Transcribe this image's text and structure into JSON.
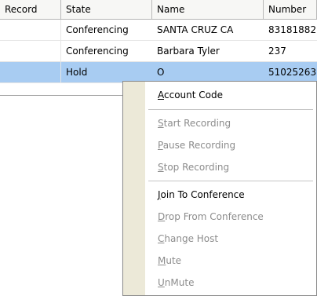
{
  "table": {
    "columns": [
      "Record",
      "State",
      "Name",
      "Number"
    ],
    "rows": [
      {
        "record": "",
        "state": "Conferencing",
        "name": "SANTA CRUZ  CA",
        "number": "83181882"
      },
      {
        "record": "",
        "state": "Conferencing",
        "name": "Barbara Tyler",
        "number": "237"
      },
      {
        "record": "",
        "state": "Hold",
        "name": "O",
        "number": "51025263"
      }
    ]
  },
  "context_menu": {
    "items": [
      {
        "label": "Account Code",
        "mnemonic": "A",
        "enabled": true
      },
      {
        "label": "Start Recording",
        "mnemonic": "S",
        "enabled": false
      },
      {
        "label": "Pause Recording",
        "mnemonic": "P",
        "enabled": false
      },
      {
        "label": "Stop Recording",
        "mnemonic": "S",
        "enabled": false
      },
      {
        "label": "Join To Conference",
        "mnemonic": "J",
        "enabled": true
      },
      {
        "label": "Drop From Conference",
        "mnemonic": "D",
        "enabled": false
      },
      {
        "label": "Change Host",
        "mnemonic": "C",
        "enabled": false
      },
      {
        "label": "Mute",
        "mnemonic": "M",
        "enabled": false
      },
      {
        "label": "UnMute",
        "mnemonic": "U",
        "enabled": false
      }
    ]
  },
  "colors": {
    "selection": "#a8ccf2",
    "disabled_text": "#8c8c8c",
    "menu_gutter": "#ece9d8"
  }
}
